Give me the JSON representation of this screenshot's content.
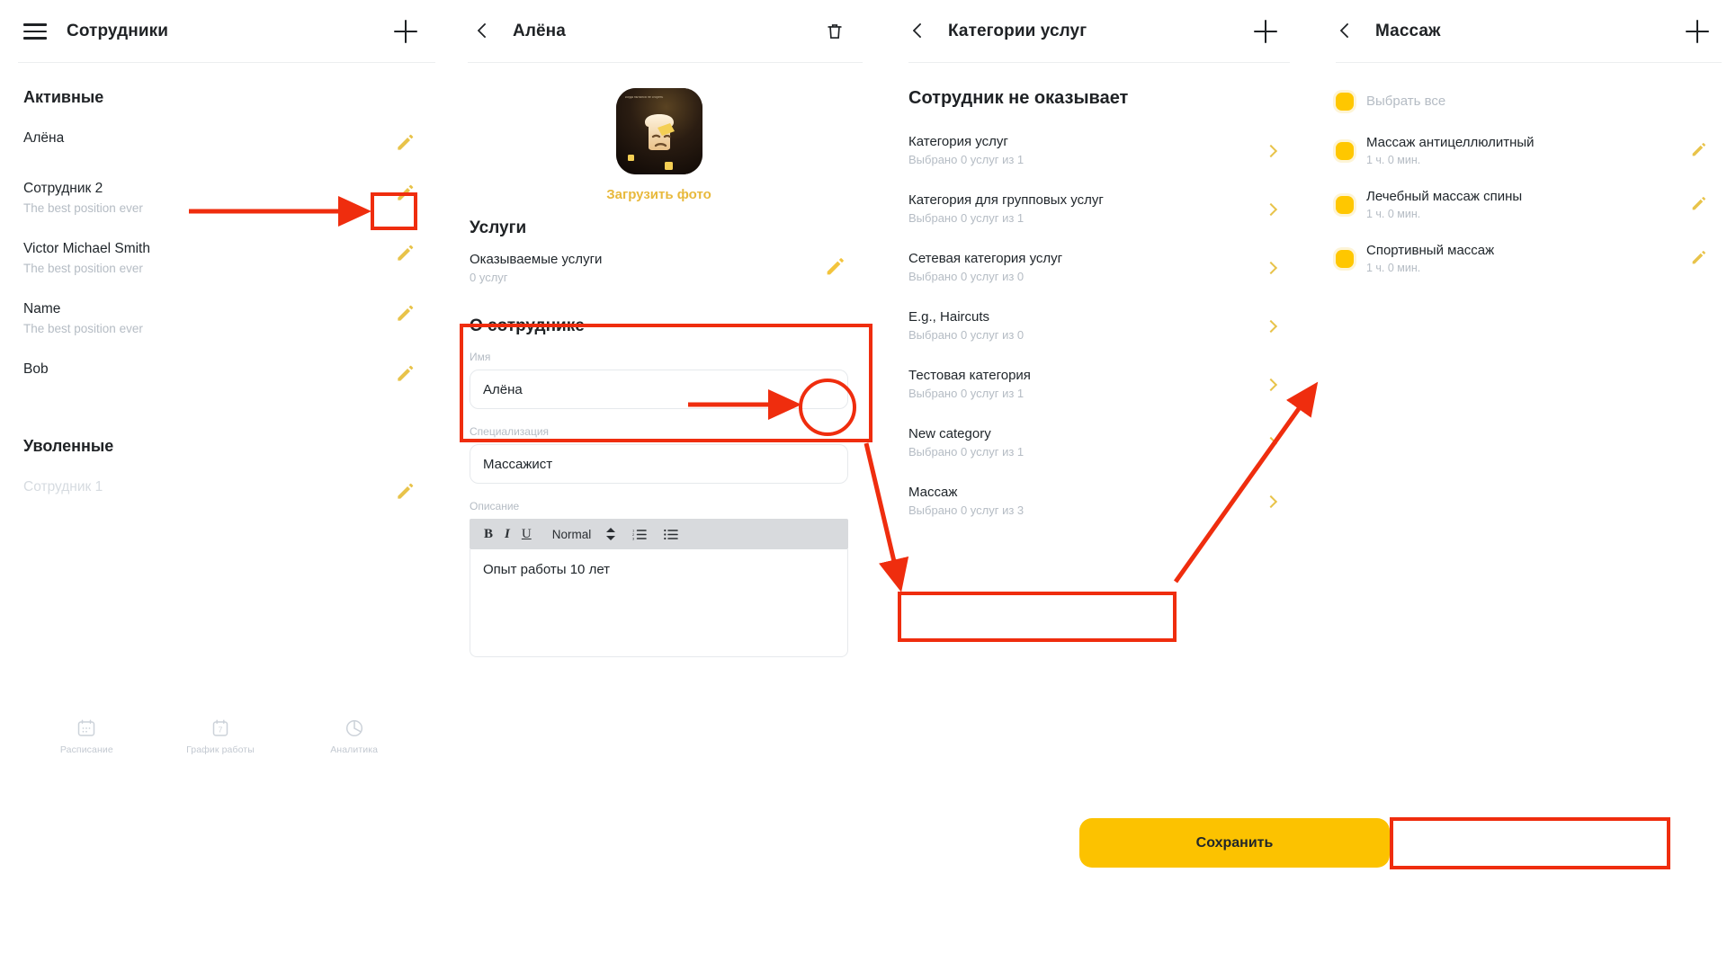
{
  "colors": {
    "accent_yellow": "#fcc200",
    "annotation_red": "#ef2d0e",
    "link_gold": "#e8b93c",
    "muted_gray": "#b5bcc4",
    "text_dark": "#20262b"
  },
  "panel_employees": {
    "title": "Сотрудники",
    "menu_icon": "hamburger-icon",
    "add_icon": "plus-icon",
    "groups": [
      {
        "heading": "Активные",
        "rows": [
          {
            "name": "Алёна",
            "position": "",
            "edit_icon": "pencil-icon"
          },
          {
            "name": "Сотрудник 2",
            "position": "The best position ever",
            "edit_icon": "pencil-icon"
          },
          {
            "name": "Victor Michael Smith",
            "position": "The best position ever",
            "edit_icon": "pencil-icon"
          },
          {
            "name": "Name",
            "position": "The best position ever",
            "edit_icon": "pencil-icon"
          },
          {
            "name": "Bob",
            "position": "",
            "edit_icon": "pencil-icon"
          }
        ]
      },
      {
        "heading": "Уволенные",
        "rows": [
          {
            "name": "Сотрудник 1",
            "position": "",
            "edit_icon": "pencil-icon"
          }
        ]
      }
    ],
    "bottom_nav": [
      {
        "label": "Расписание",
        "icon": "calendar-icon"
      },
      {
        "label": "График работы",
        "icon": "calendar-7-icon"
      },
      {
        "label": "Аналитика",
        "icon": "pie-chart-icon"
      }
    ]
  },
  "panel_employee_detail": {
    "title": "Алёна",
    "back_icon": "back-chevron-icon",
    "delete_icon": "trash-icon",
    "avatar_alt": "sad-toast-avatar",
    "upload_photo_label": "Загрузить фото",
    "services_section": {
      "title": "Услуги",
      "row_title": "Оказываемые услуги",
      "row_sub": "0 услуг",
      "edit_icon": "pencil-icon"
    },
    "about_section": {
      "title": "О сотруднике",
      "name_label": "Имя",
      "name_value": "Алёна",
      "spec_label": "Специализация",
      "spec_value": "Массажист",
      "desc_label": "Описание",
      "toolbar": {
        "bold": "B",
        "italic": "I",
        "underline": "U",
        "style_select": "Normal",
        "ordered_list_icon": "ordered-list-icon",
        "bullet_list_icon": "bullet-list-icon"
      },
      "desc_value": "Опыт работы 10 лет"
    }
  },
  "panel_categories": {
    "title": "Категории услуг",
    "back_icon": "back-chevron-icon",
    "add_icon": "plus-icon",
    "heading": "Сотрудник не оказывает",
    "rows": [
      {
        "name": "Категория услуг",
        "sub": "Выбрано 0 услуг из 1",
        "chevron": "chevron-right-icon"
      },
      {
        "name": "Категория для групповых услуг",
        "sub": "Выбрано 0 услуг из 1",
        "chevron": "chevron-right-icon"
      },
      {
        "name": "Сетевая категория услуг",
        "sub": "Выбрано 0 услуг из 0",
        "chevron": "chevron-right-icon"
      },
      {
        "name": "E.g., Haircuts",
        "sub": "Выбрано 0 услуг из 0",
        "chevron": "chevron-right-icon"
      },
      {
        "name": "Тестовая категория",
        "sub": "Выбрано 0 услуг из 1",
        "chevron": "chevron-right-icon"
      },
      {
        "name": "New category",
        "sub": "Выбрано 0 услуг из 1",
        "chevron": "chevron-right-icon"
      },
      {
        "name": "Массаж",
        "sub": "Выбрано 0 услуг из 3",
        "chevron": "chevron-right-icon"
      }
    ]
  },
  "panel_massage": {
    "title": "Массаж",
    "back_icon": "back-chevron-icon",
    "add_icon": "plus-icon",
    "select_all_label": "Выбрать все",
    "rows": [
      {
        "name": "Массаж антицеллюлитный",
        "sub": "1 ч. 0 мин.",
        "edit_icon": "pencil-icon"
      },
      {
        "name": "Лечебный массаж спины",
        "sub": "1 ч. 0 мин.",
        "edit_icon": "pencil-icon"
      },
      {
        "name": "Спортивный массаж",
        "sub": "1 ч. 0 мин.",
        "edit_icon": "pencil-icon"
      }
    ],
    "save_label": "Сохранить"
  }
}
